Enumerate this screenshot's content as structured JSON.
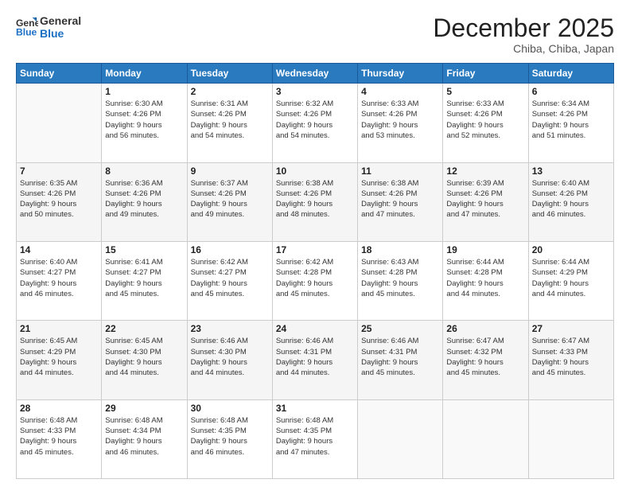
{
  "header": {
    "logo_line1": "General",
    "logo_line2": "Blue",
    "month": "December 2025",
    "location": "Chiba, Chiba, Japan"
  },
  "weekdays": [
    "Sunday",
    "Monday",
    "Tuesday",
    "Wednesday",
    "Thursday",
    "Friday",
    "Saturday"
  ],
  "weeks": [
    [
      {
        "day": "",
        "text": ""
      },
      {
        "day": "1",
        "text": "Sunrise: 6:30 AM\nSunset: 4:26 PM\nDaylight: 9 hours\nand 56 minutes."
      },
      {
        "day": "2",
        "text": "Sunrise: 6:31 AM\nSunset: 4:26 PM\nDaylight: 9 hours\nand 54 minutes."
      },
      {
        "day": "3",
        "text": "Sunrise: 6:32 AM\nSunset: 4:26 PM\nDaylight: 9 hours\nand 54 minutes."
      },
      {
        "day": "4",
        "text": "Sunrise: 6:33 AM\nSunset: 4:26 PM\nDaylight: 9 hours\nand 53 minutes."
      },
      {
        "day": "5",
        "text": "Sunrise: 6:33 AM\nSunset: 4:26 PM\nDaylight: 9 hours\nand 52 minutes."
      },
      {
        "day": "6",
        "text": "Sunrise: 6:34 AM\nSunset: 4:26 PM\nDaylight: 9 hours\nand 51 minutes."
      }
    ],
    [
      {
        "day": "7",
        "text": "Sunrise: 6:35 AM\nSunset: 4:26 PM\nDaylight: 9 hours\nand 50 minutes."
      },
      {
        "day": "8",
        "text": "Sunrise: 6:36 AM\nSunset: 4:26 PM\nDaylight: 9 hours\nand 49 minutes."
      },
      {
        "day": "9",
        "text": "Sunrise: 6:37 AM\nSunset: 4:26 PM\nDaylight: 9 hours\nand 49 minutes."
      },
      {
        "day": "10",
        "text": "Sunrise: 6:38 AM\nSunset: 4:26 PM\nDaylight: 9 hours\nand 48 minutes."
      },
      {
        "day": "11",
        "text": "Sunrise: 6:38 AM\nSunset: 4:26 PM\nDaylight: 9 hours\nand 47 minutes."
      },
      {
        "day": "12",
        "text": "Sunrise: 6:39 AM\nSunset: 4:26 PM\nDaylight: 9 hours\nand 47 minutes."
      },
      {
        "day": "13",
        "text": "Sunrise: 6:40 AM\nSunset: 4:26 PM\nDaylight: 9 hours\nand 46 minutes."
      }
    ],
    [
      {
        "day": "14",
        "text": "Sunrise: 6:40 AM\nSunset: 4:27 PM\nDaylight: 9 hours\nand 46 minutes."
      },
      {
        "day": "15",
        "text": "Sunrise: 6:41 AM\nSunset: 4:27 PM\nDaylight: 9 hours\nand 45 minutes."
      },
      {
        "day": "16",
        "text": "Sunrise: 6:42 AM\nSunset: 4:27 PM\nDaylight: 9 hours\nand 45 minutes."
      },
      {
        "day": "17",
        "text": "Sunrise: 6:42 AM\nSunset: 4:28 PM\nDaylight: 9 hours\nand 45 minutes."
      },
      {
        "day": "18",
        "text": "Sunrise: 6:43 AM\nSunset: 4:28 PM\nDaylight: 9 hours\nand 45 minutes."
      },
      {
        "day": "19",
        "text": "Sunrise: 6:44 AM\nSunset: 4:28 PM\nDaylight: 9 hours\nand 44 minutes."
      },
      {
        "day": "20",
        "text": "Sunrise: 6:44 AM\nSunset: 4:29 PM\nDaylight: 9 hours\nand 44 minutes."
      }
    ],
    [
      {
        "day": "21",
        "text": "Sunrise: 6:45 AM\nSunset: 4:29 PM\nDaylight: 9 hours\nand 44 minutes."
      },
      {
        "day": "22",
        "text": "Sunrise: 6:45 AM\nSunset: 4:30 PM\nDaylight: 9 hours\nand 44 minutes."
      },
      {
        "day": "23",
        "text": "Sunrise: 6:46 AM\nSunset: 4:30 PM\nDaylight: 9 hours\nand 44 minutes."
      },
      {
        "day": "24",
        "text": "Sunrise: 6:46 AM\nSunset: 4:31 PM\nDaylight: 9 hours\nand 44 minutes."
      },
      {
        "day": "25",
        "text": "Sunrise: 6:46 AM\nSunset: 4:31 PM\nDaylight: 9 hours\nand 45 minutes."
      },
      {
        "day": "26",
        "text": "Sunrise: 6:47 AM\nSunset: 4:32 PM\nDaylight: 9 hours\nand 45 minutes."
      },
      {
        "day": "27",
        "text": "Sunrise: 6:47 AM\nSunset: 4:33 PM\nDaylight: 9 hours\nand 45 minutes."
      }
    ],
    [
      {
        "day": "28",
        "text": "Sunrise: 6:48 AM\nSunset: 4:33 PM\nDaylight: 9 hours\nand 45 minutes."
      },
      {
        "day": "29",
        "text": "Sunrise: 6:48 AM\nSunset: 4:34 PM\nDaylight: 9 hours\nand 46 minutes."
      },
      {
        "day": "30",
        "text": "Sunrise: 6:48 AM\nSunset: 4:35 PM\nDaylight: 9 hours\nand 46 minutes."
      },
      {
        "day": "31",
        "text": "Sunrise: 6:48 AM\nSunset: 4:35 PM\nDaylight: 9 hours\nand 47 minutes."
      },
      {
        "day": "",
        "text": ""
      },
      {
        "day": "",
        "text": ""
      },
      {
        "day": "",
        "text": ""
      }
    ]
  ]
}
